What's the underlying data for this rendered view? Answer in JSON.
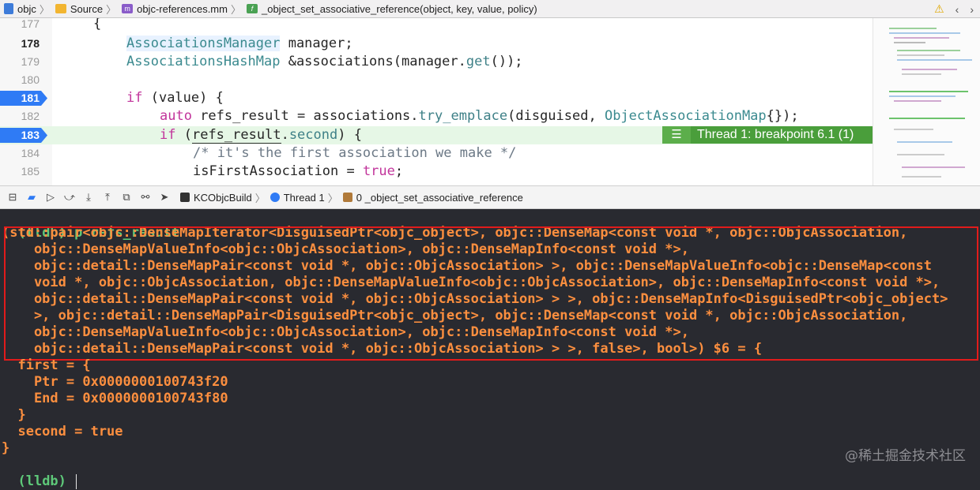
{
  "jumpbar": {
    "items": [
      "objc",
      "Source",
      "objc-references.mm",
      "_object_set_associative_reference(object, key, value, policy)"
    ],
    "right_icons": [
      "warning-icon",
      "back-icon",
      "forward-icon"
    ]
  },
  "editor": {
    "lines": [
      {
        "num": "177",
        "code": "{"
      },
      {
        "num": "178",
        "code": "AssociationsManager manager;"
      },
      {
        "num": "179",
        "code": "AssociationsHashMap &associations(manager.get());"
      },
      {
        "num": "180",
        "code": ""
      },
      {
        "num": "181",
        "code": "if (value) {"
      },
      {
        "num": "182",
        "code": "auto refs_result = associations.try_emplace(disguised, ObjectAssociationMap{});"
      },
      {
        "num": "183",
        "code": "if (refs_result.second) {"
      },
      {
        "num": "184",
        "code": "/* it's the first association we make */"
      },
      {
        "num": "185",
        "code": "isFirstAssociation = true;"
      }
    ],
    "breakpoint_label": "Thread 1: breakpoint 6.1 (1)",
    "breakpoint_lines": [
      "181",
      "183"
    ]
  },
  "debugbar": {
    "scheme": "KCObjcBuild",
    "thread": "Thread 1",
    "frame": "0 _object_set_associative_reference"
  },
  "console": {
    "prompt": "(lldb)",
    "command": "p refs_result",
    "type_lines": [
      "(std::pair<objc::DenseMapIterator<DisguisedPtr<objc_object>, objc::DenseMap<const void *, objc::ObjcAssociation,",
      "    objc::DenseMapValueInfo<objc::ObjcAssociation>, objc::DenseMapInfo<const void *>,",
      "    objc::detail::DenseMapPair<const void *, objc::ObjcAssociation> >, objc::DenseMapValueInfo<objc::DenseMap<const",
      "    void *, objc::ObjcAssociation, objc::DenseMapValueInfo<objc::ObjcAssociation>, objc::DenseMapInfo<const void *>,",
      "    objc::detail::DenseMapPair<const void *, objc::ObjcAssociation> > >, objc::DenseMapInfo<DisguisedPtr<objc_object>",
      "    >, objc::detail::DenseMapPair<DisguisedPtr<objc_object>, objc::DenseMap<const void *, objc::ObjcAssociation,",
      "    objc::DenseMapValueInfo<objc::ObjcAssociation>, objc::DenseMapInfo<const void *>,",
      "    objc::detail::DenseMapPair<const void *, objc::ObjcAssociation> > >, false>, bool>) $6 = {"
    ],
    "body_lines": [
      "  first = {",
      "    Ptr = 0x0000000100743f20",
      "    End = 0x0000000100743f80",
      "  }",
      "  second = true",
      "}"
    ],
    "final_prompt": "(lldb)",
    "watermark": "@稀土掘金技术社区"
  },
  "colors": {
    "console_bg": "#292a30",
    "prompt_green": "#5ec979",
    "output_orange": "#fd8f3f",
    "highlight_box": "#e21b1b",
    "breakpoint_blue": "#2f7bf5",
    "annotation_green": "#4a9e3b"
  }
}
